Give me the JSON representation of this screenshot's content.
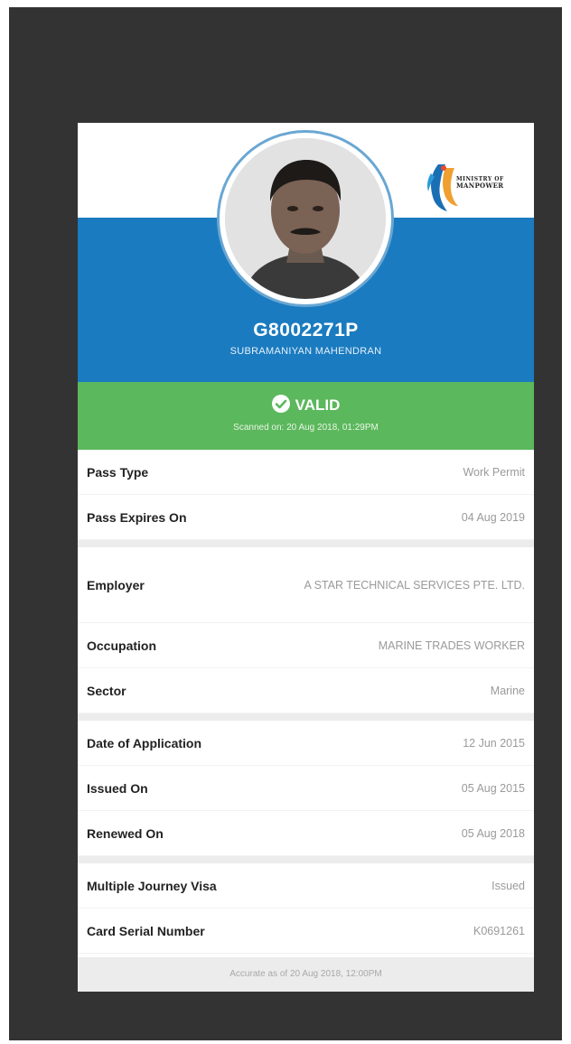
{
  "ministry": {
    "logo_line1": "MINISTRY OF",
    "logo_line2": "MANPOWER"
  },
  "pass": {
    "number": "G8002271P",
    "holder_name": "SUBRAMANIYAN MAHENDRAN"
  },
  "status": {
    "label": "VALID",
    "scanned_on": "Scanned on: 20 Aug 2018, 01:29PM"
  },
  "details": {
    "pass_type": {
      "label": "Pass Type",
      "value": "Work Permit"
    },
    "pass_expires_on": {
      "label": "Pass Expires On",
      "value": "04 Aug 2019"
    },
    "employer": {
      "label": "Employer",
      "value": "A STAR TECHNICAL SERVICES PTE. LTD."
    },
    "occupation": {
      "label": "Occupation",
      "value": "MARINE TRADES WORKER"
    },
    "sector": {
      "label": "Sector",
      "value": "Marine"
    },
    "date_of_application": {
      "label": "Date of Application",
      "value": "12 Jun 2015"
    },
    "issued_on": {
      "label": "Issued On",
      "value": "05 Aug 2015"
    },
    "renewed_on": {
      "label": "Renewed On",
      "value": "05 Aug 2018"
    },
    "multiple_journey_visa": {
      "label": "Multiple Journey Visa",
      "value": "Issued"
    },
    "card_serial_number": {
      "label": "Card Serial Number",
      "value": "K0691261"
    }
  },
  "footer": {
    "accurate_as_of": "Accurate as of 20 Aug 2018, 12:00PM"
  },
  "colors": {
    "header_blue": "#1a7bc0",
    "valid_green": "#5cb85c",
    "frame_dark": "#333333"
  }
}
